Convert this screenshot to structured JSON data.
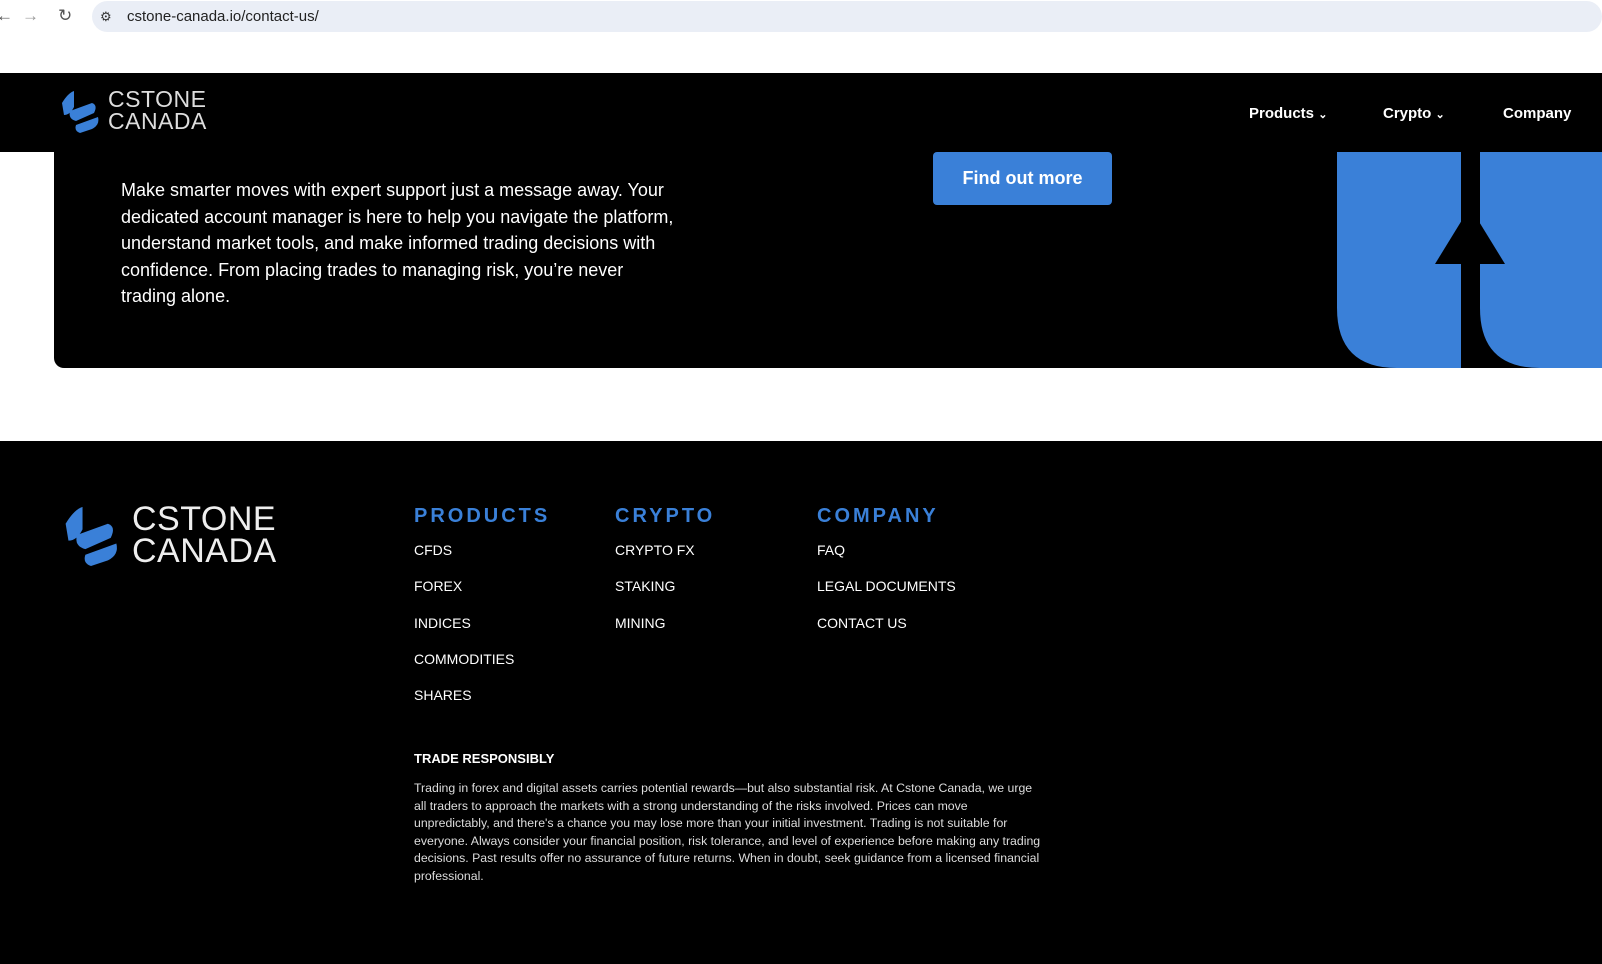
{
  "browser": {
    "url": "cstone-canada.io/contact-us/"
  },
  "brand": {
    "line1": "CSTONE",
    "line2": "CANADA",
    "color": "#3a80d8"
  },
  "nav": {
    "items": [
      {
        "label": "Products"
      },
      {
        "label": "Crypto"
      },
      {
        "label": "Company"
      }
    ]
  },
  "hero": {
    "text": "Make smarter moves with expert support just a message away. Your dedicated account manager is here to help you navigate the platform, understand market tools, and make informed trading decisions with confidence. From placing trades to managing risk, you’re never trading alone.",
    "cta": "Find out more"
  },
  "footer": {
    "columns": [
      {
        "title": "PRODUCTS",
        "links": [
          "CFDS",
          "FOREX",
          "INDICES",
          "COMMODITIES",
          "SHARES"
        ]
      },
      {
        "title": "CRYPTO",
        "links": [
          "CRYPTO FX",
          "STAKING",
          "MINING"
        ]
      },
      {
        "title": "COMPANY",
        "links": [
          "FAQ",
          "LEGAL DOCUMENTS",
          "CONTACT US"
        ]
      }
    ],
    "trade_title": "TRADE RESPONSIBLY",
    "trade_text": "Trading in forex and digital assets carries potential rewards—but also substantial risk. At Cstone Canada, we urge all traders to approach the markets with a strong understanding of the risks involved. Prices can move unpredictably, and there's a chance you may lose more than your initial investment. Trading is not suitable for everyone. Always consider your financial position, risk tolerance, and level of experience before making any trading decisions. Past results offer no assurance of future returns. When in doubt, seek guidance from a licensed financial professional."
  }
}
